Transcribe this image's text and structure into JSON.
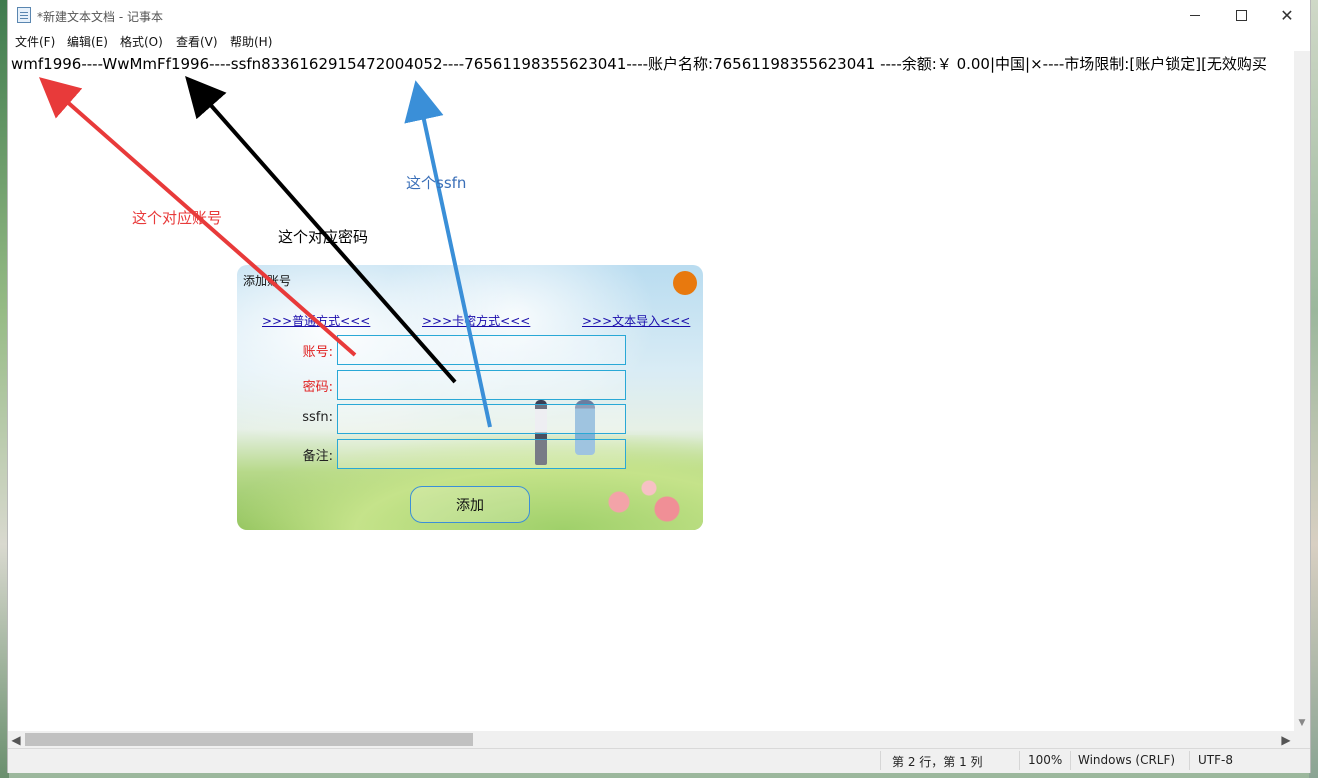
{
  "window": {
    "title": "*新建文本文档 - 记事本",
    "buttons": {
      "minimize": "—",
      "maximize": "☐",
      "close": "✕"
    }
  },
  "menu": [
    "文件(F)",
    "编辑(E)",
    "格式(O)",
    "查看(V)",
    "帮助(H)"
  ],
  "editor": {
    "line1": "wmf1996----WwMmFf1996----ssfn8336162915472004052----76561198355623041----账户名称:76561198355623041 ----余额:￥ 0.00|中国|×----市场限制:[账户锁定][无效购买"
  },
  "statusbar": {
    "position": "第 2 行，第 1 列",
    "zoom": "100%",
    "line_ending": "Windows (CRLF)",
    "encoding": "UTF-8"
  },
  "annotations": {
    "account": {
      "text": "这个对应账号",
      "color": "#e83a3a"
    },
    "password": {
      "text": "这个对应密码",
      "color": "#000000"
    },
    "ssfn": {
      "text": "这个ssfn",
      "color": "#3a6fb8"
    }
  },
  "dialog": {
    "title": "添加账号",
    "tabs": [
      ">>>普通方式<<<",
      ">>>卡密方式<<<",
      ">>>文本导入<<<"
    ],
    "fields": {
      "account_label": "账号:",
      "password_label": "密码:",
      "ssfn_label": "ssfn:",
      "note_label": "备注:"
    },
    "add_button": "添加",
    "close_color": "#e8790e"
  },
  "icons": {
    "app": "notepad-icon",
    "close_dot": "close-dot-icon",
    "scroll_left": "◀",
    "scroll_right": "▶",
    "scroll_down": "▼"
  }
}
